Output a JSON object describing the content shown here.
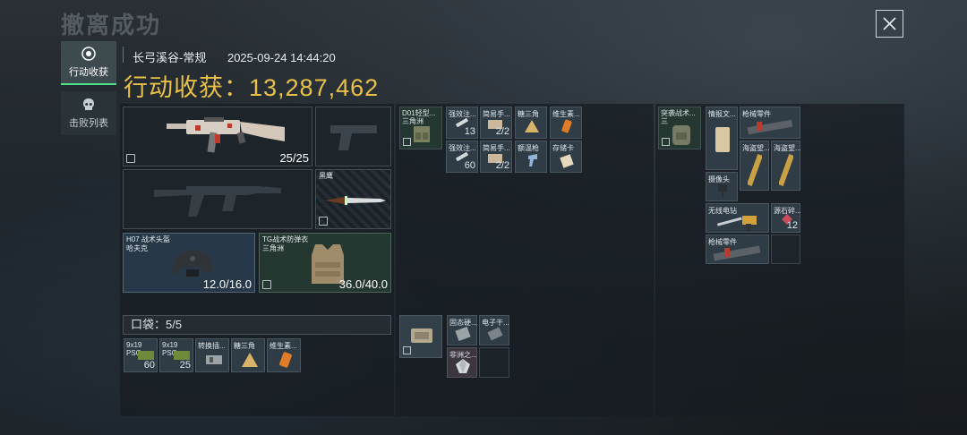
{
  "header": {
    "title": "撤离成功",
    "map_mode": "长弓溪谷-常规",
    "datetime": "2025-09-24 14:44:20",
    "earnings_label": "行动收获：",
    "earnings_value": "13,287,462"
  },
  "tabs": [
    {
      "label": "行动收获",
      "active": true,
      "icon": "loot-icon"
    },
    {
      "label": "击败列表",
      "active": false,
      "icon": "skull-icon"
    }
  ],
  "equipment": {
    "primary_weapon": {
      "ammo": "25/25"
    },
    "melee": {
      "label": "黑鹰"
    },
    "helmet": {
      "label": "H07 战术头盔\n哈夫克",
      "durability": "12.0/16.0"
    },
    "armor": {
      "label": "TG战术防弹衣\n三角洲",
      "durability": "36.0/40.0"
    }
  },
  "pocket": {
    "label": "口袋：",
    "capacity": "5/5",
    "items": [
      {
        "label": "9x19\nPSO",
        "count": "60"
      },
      {
        "label": "9x19\nPSO",
        "count": "25"
      },
      {
        "label": "转换插...",
        "count": ""
      },
      {
        "label": "糖三角",
        "count": ""
      },
      {
        "label": "维生素...",
        "count": ""
      }
    ]
  },
  "chest_rig": {
    "container_label": "D01轻型...\n三角洲",
    "items": [
      {
        "label": "强效注...",
        "count": "13"
      },
      {
        "label": "简易手...",
        "count": "2/2"
      },
      {
        "label": "糖三角",
        "count": ""
      },
      {
        "label": "维生素...",
        "count": ""
      },
      {
        "label": "强效注...",
        "count": "60"
      },
      {
        "label": "简易手...",
        "count": "2/2"
      },
      {
        "label": "额温枪",
        "count": ""
      },
      {
        "label": "存储卡",
        "count": ""
      }
    ]
  },
  "safe_box": {
    "items": [
      {
        "label": "固态硬..."
      },
      {
        "label": "电子干..."
      },
      {
        "label": "非洲之..."
      }
    ]
  },
  "backpack": {
    "container_label": "突袭战术...\n三",
    "items": [
      {
        "label": "情报文...",
        "count": ""
      },
      {
        "label": "枪械零件",
        "count": ""
      },
      {
        "label": "海盗望...",
        "count": ""
      },
      {
        "label": "海盗望...",
        "count": ""
      },
      {
        "label": "摄像头",
        "count": ""
      },
      {
        "label": "无线电钻",
        "count": ""
      },
      {
        "label": "源石碎...",
        "count": "12"
      },
      {
        "label": "枪械零件",
        "count": ""
      }
    ]
  },
  "colors": {
    "earnings": "#e8c04a",
    "active_tab_accent": "#4fe08e"
  }
}
